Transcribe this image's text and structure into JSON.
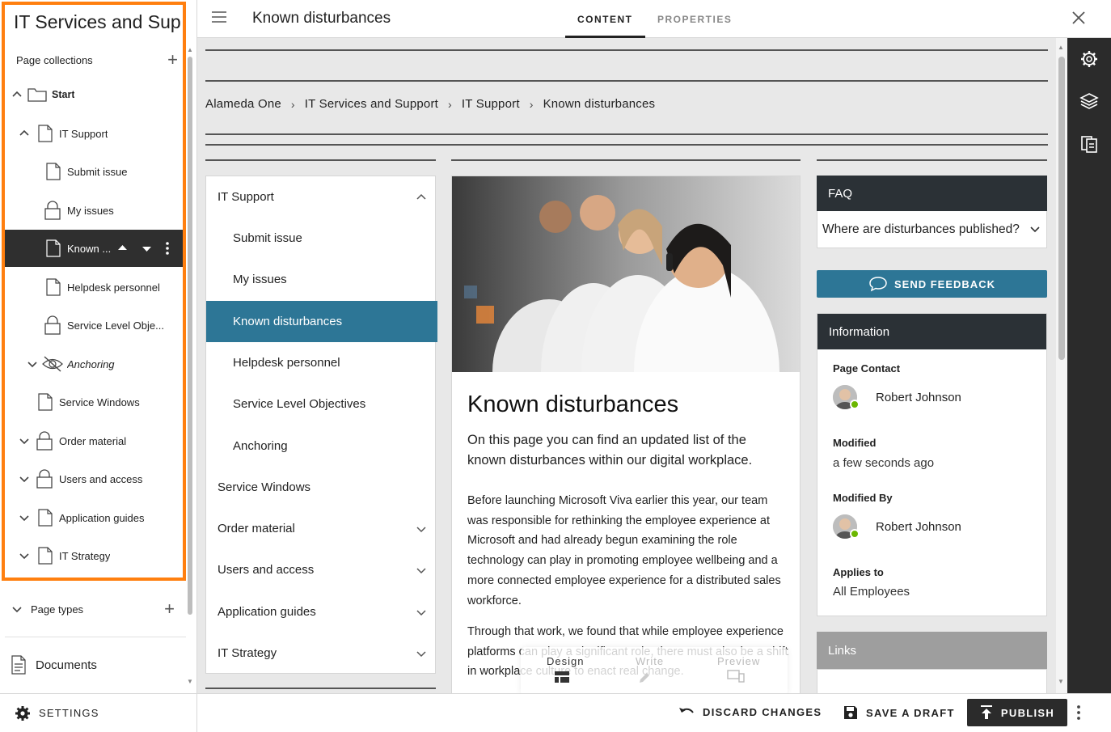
{
  "sidebar": {
    "site_title": "IT Services and Sup",
    "page_collections_label": "Page collections",
    "tree": [
      {
        "label": "Start"
      },
      {
        "label": "IT Support"
      },
      {
        "label": "Submit issue"
      },
      {
        "label": "My issues"
      },
      {
        "label": "Known ..."
      },
      {
        "label": "Helpdesk personnel"
      },
      {
        "label": "Service Level Obje..."
      },
      {
        "label": "Anchoring"
      },
      {
        "label": "Service Windows"
      },
      {
        "label": "Order material"
      },
      {
        "label": "Users and access"
      },
      {
        "label": "Application guides"
      },
      {
        "label": "IT Strategy"
      }
    ],
    "page_types_label": "Page types",
    "documents_label": "Documents",
    "settings_label": "SETTINGS",
    "highlight_color": "#ff7f0f"
  },
  "topbar": {
    "page_name": "Known disturbances",
    "tabs": [
      {
        "label": "CONTENT"
      },
      {
        "label": "PROPERTIES"
      }
    ]
  },
  "breadcrumb": [
    "Alameda One",
    "IT Services and Support",
    "IT Support",
    "Known disturbances"
  ],
  "nav": {
    "items": [
      {
        "label": "IT Support"
      },
      {
        "label": "Submit issue"
      },
      {
        "label": "My issues"
      },
      {
        "label": "Known disturbances"
      },
      {
        "label": "Helpdesk personnel"
      },
      {
        "label": "Service Level Objectives"
      },
      {
        "label": "Anchoring"
      },
      {
        "label": "Service Windows"
      },
      {
        "label": "Order material"
      },
      {
        "label": "Users and access"
      },
      {
        "label": "Application guides"
      },
      {
        "label": "IT Strategy"
      }
    ],
    "active_color": "#2d7696"
  },
  "article": {
    "title": "Known disturbances",
    "lead": "On this page you can find an updated list of the known disturbances within our digital workplace.",
    "body1": "Before launching Microsoft Viva earlier this year, our team was responsible for rethinking the employee experience at Microsoft and had already begun examining the role technology can play in promoting employee wellbeing and a more connected employee experience for a distributed sales workforce.",
    "body2": "Through that work, we found that while employee experience platforms can play a significant role, there must also be a shift in workplace culture to enact real change."
  },
  "float_tools": [
    "Design",
    "Write",
    "Preview"
  ],
  "faq": {
    "heading": "FAQ",
    "question": "Where are disturbances published?"
  },
  "feedback_label": "SEND FEEDBACK",
  "info": {
    "heading": "Information",
    "page_contact_label": "Page Contact",
    "page_contact_name": "Robert Johnson",
    "modified_label": "Modified",
    "modified_value": "a few seconds ago",
    "modified_by_label": "Modified By",
    "modified_by_name": "Robert Johnson",
    "applies_to_label": "Applies to",
    "applies_to_value": "All Employees"
  },
  "links_heading": "Links",
  "bottombar": {
    "discard_label": "DISCARD CHANGES",
    "save_label": "SAVE A DRAFT",
    "publish_label": "PUBLISH"
  }
}
